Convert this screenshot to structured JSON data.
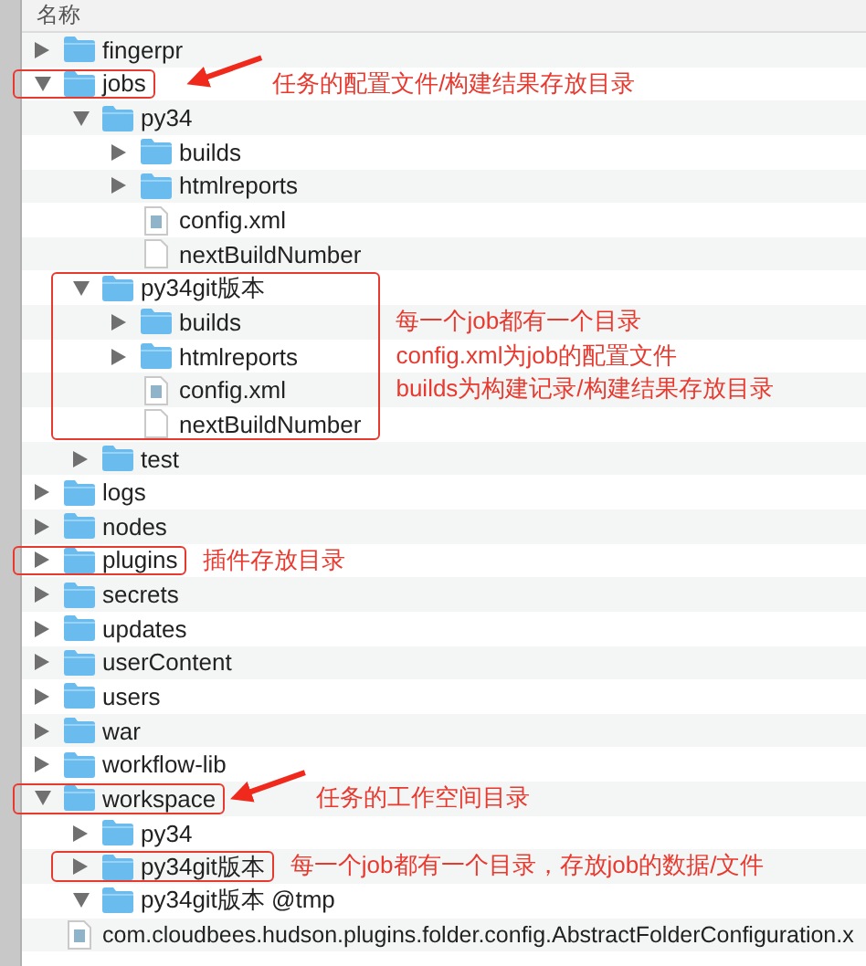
{
  "header": {
    "label": "名称"
  },
  "tree": [
    {
      "name": "fingerpr",
      "kind": "folder",
      "expanded": false
    },
    {
      "name": "jobs",
      "kind": "folder",
      "expanded": true,
      "boxed": true,
      "arrow": true,
      "callout": [
        "任务的配置文件/构建结果存放目录"
      ],
      "children": [
        {
          "name": "py34",
          "kind": "folder",
          "expanded": true,
          "children": [
            {
              "name": "builds",
              "kind": "folder",
              "expanded": false
            },
            {
              "name": "htmlreports",
              "kind": "folder",
              "expanded": false
            },
            {
              "name": "config.xml",
              "kind": "xml"
            },
            {
              "name": "nextBuildNumber",
              "kind": "file"
            }
          ]
        },
        {
          "name": "py34git版本",
          "kind": "folder",
          "expanded": true,
          "boxed": true,
          "box_includes_children": true,
          "callout": [
            "每一个job都有一个目录",
            "config.xml为job的配置文件",
            "builds为构建记录/构建结果存放目录"
          ],
          "children": [
            {
              "name": "builds",
              "kind": "folder",
              "expanded": false
            },
            {
              "name": "htmlreports",
              "kind": "folder",
              "expanded": false
            },
            {
              "name": "config.xml",
              "kind": "xml"
            },
            {
              "name": "nextBuildNumber",
              "kind": "file"
            }
          ]
        },
        {
          "name": "test",
          "kind": "folder",
          "expanded": false
        }
      ]
    },
    {
      "name": "logs",
      "kind": "folder",
      "expanded": false
    },
    {
      "name": "nodes",
      "kind": "folder",
      "expanded": false
    },
    {
      "name": "plugins",
      "kind": "folder",
      "expanded": false,
      "boxed": true,
      "callout": [
        "插件存放目录"
      ]
    },
    {
      "name": "secrets",
      "kind": "folder",
      "expanded": false
    },
    {
      "name": "updates",
      "kind": "folder",
      "expanded": false
    },
    {
      "name": "userContent",
      "kind": "folder",
      "expanded": false
    },
    {
      "name": "users",
      "kind": "folder",
      "expanded": false
    },
    {
      "name": "war",
      "kind": "folder",
      "expanded": false
    },
    {
      "name": "workflow-lib",
      "kind": "folder",
      "expanded": false
    },
    {
      "name": "workspace",
      "kind": "folder",
      "expanded": true,
      "boxed": true,
      "arrow": true,
      "callout": [
        "任务的工作空间目录"
      ],
      "children": [
        {
          "name": "py34",
          "kind": "folder",
          "expanded": false
        },
        {
          "name": "py34git版本",
          "kind": "folder",
          "expanded": false,
          "boxed": true,
          "callout": [
            "每一个job都有一个目录，存放job的数据/文件"
          ]
        },
        {
          "name": "py34git版本 @tmp",
          "kind": "folder",
          "expanded": true
        }
      ]
    },
    {
      "name": "com.cloudbees.hudson.plugins.folder.config.AbstractFolderConfiguration.x",
      "kind": "xml"
    }
  ]
}
